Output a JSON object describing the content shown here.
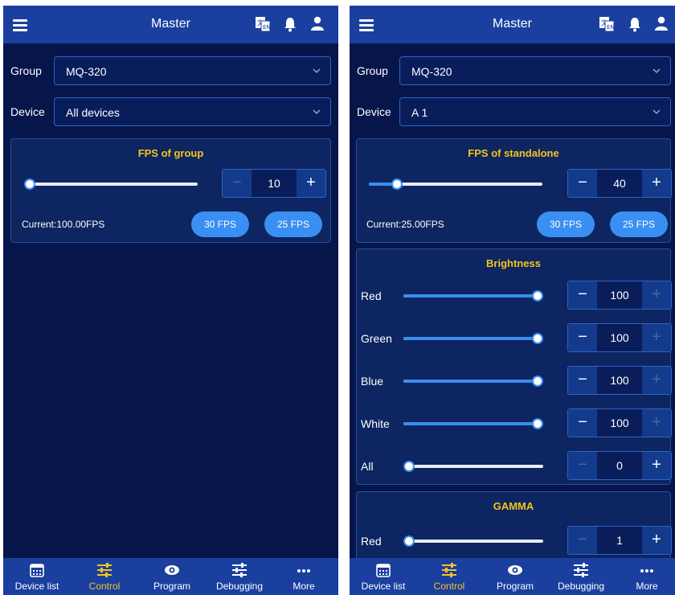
{
  "colors": {
    "accent": "#f5c41c",
    "primary": "#3a8df0",
    "background": "#06154a",
    "bar": "#1a3f9f"
  },
  "header": {
    "title": "Master"
  },
  "icons": {
    "menu": "menu-icon",
    "language": "translate-icon",
    "notifications": "bell-icon",
    "account": "user-icon"
  },
  "left": {
    "group": {
      "label": "Group",
      "value": "MQ-320"
    },
    "device": {
      "label": "Device",
      "value": "All devices"
    },
    "fps": {
      "title": "FPS of group",
      "value": "10",
      "level": 0.0,
      "current": "Current:100.00FPS",
      "presets": [
        "30 FPS",
        "25 FPS"
      ]
    }
  },
  "right": {
    "group": {
      "label": "Group",
      "value": "MQ-320"
    },
    "device": {
      "label": "Device",
      "value": "A 1"
    },
    "fps": {
      "title": "FPS of standalone",
      "value": "40",
      "level": 0.16,
      "current": "Current:25.00FPS",
      "presets": [
        "30 FPS",
        "25 FPS"
      ]
    },
    "brightness": {
      "title": "Brightness",
      "rows": [
        {
          "label": "Red",
          "value": "100",
          "level": 1.0
        },
        {
          "label": "Green",
          "value": "100",
          "level": 1.0
        },
        {
          "label": "Blue",
          "value": "100",
          "level": 1.0
        },
        {
          "label": "White",
          "value": "100",
          "level": 1.0
        },
        {
          "label": "All",
          "value": "0",
          "level": 0.0
        }
      ]
    },
    "gamma": {
      "title": "GAMMA",
      "rows": [
        {
          "label": "Red",
          "value": "1",
          "level": 0.0
        }
      ]
    }
  },
  "nav": {
    "items": [
      {
        "label": "Device list",
        "icon": "calendar-icon"
      },
      {
        "label": "Control",
        "icon": "sliders-icon",
        "active": true
      },
      {
        "label": "Program",
        "icon": "eye-icon"
      },
      {
        "label": "Debugging",
        "icon": "sliders-icon"
      },
      {
        "label": "More",
        "icon": "more-icon"
      }
    ]
  },
  "stepper": {
    "minus": "−",
    "plus": "+"
  }
}
